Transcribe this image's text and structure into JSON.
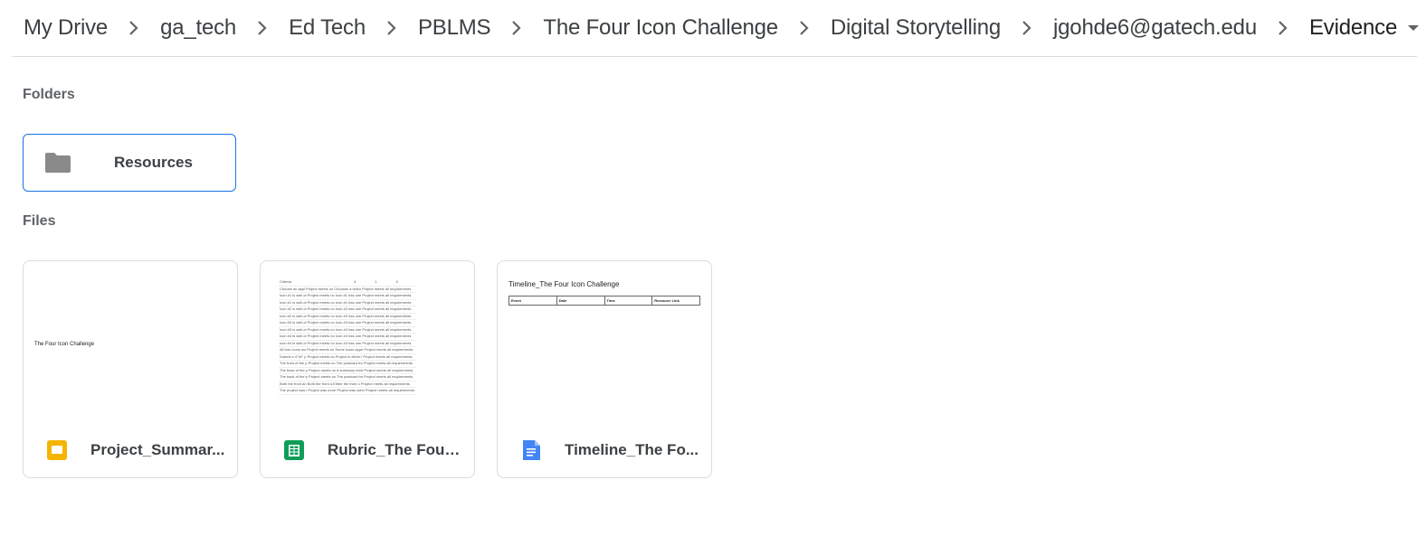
{
  "breadcrumb": {
    "items": [
      "My Drive",
      "ga_tech",
      "Ed Tech",
      "PBLMS",
      "The Four Icon Challenge",
      "Digital Storytelling",
      "jgohde6@gatech.edu"
    ],
    "current": "Evidence"
  },
  "sections": {
    "folders_label": "Folders",
    "files_label": "Files"
  },
  "folders": [
    {
      "name": "Resources",
      "icon": "folder-icon"
    }
  ],
  "files": [
    {
      "name": "Project_Summar...",
      "type": "slides",
      "icon": "google-slides-icon",
      "thumb_title": "The Four Icon Challenge"
    },
    {
      "name": "Rubric_The Four ...",
      "type": "sheets",
      "icon": "google-sheets-icon",
      "thumb_header": [
        "Criteria",
        "3",
        "1",
        "0"
      ],
      "thumb_rows": [
        "Choose an appl Project meets no Chooses a video Project meets all requirements",
        "Icon #1 is well-ct Project meets no Icon #1 has one Project meets all requirements",
        "Icon #1 is well-ct Project meets no Icon #1 has one Project meets all requirements",
        "Icon #2 is well-ct Project meets no Icon #2 has one Project meets all requirements",
        "Icon #2 is well-ct Project meets no Icon #2 has one Project meets all requirements",
        "Icon #3 is well-ct Project meets no Icon #3 has one Project meets all requirements",
        "Icon #3 is well-ct Project meets no Icon #3 has one Project meets all requirements",
        "Icon #4 is well-ct Project meets no Icon #4 has one Project meets all requirements",
        "Icon #4 is well-ct Project meets no Icon #3 has one Project meets all requirements",
        "All four icons wo Project meets no Some icons appe Project meets all requirements",
        "Submit a 4\"x6\" p Project meets no Project is either i Project meets all requirements",
        "The front of the p Project meets no The postcard fro Project meets all requirements",
        "The back of the p Project meets no A summary exist Project meets all requirements",
        "The back of the p Project meets no The postcard fro Project meets all requirements",
        "Both the front an Both the front a Either the front o Project meets all requirements",
        "The project was i Project was more Project was subn Project meets all requirements"
      ]
    },
    {
      "name": "Timeline_The Fo...",
      "type": "docs",
      "icon": "google-docs-icon",
      "thumb_title": "Timeline_The Four Icon Challenge",
      "thumb_columns": [
        "Event",
        "Date",
        "Time",
        "Resource Link"
      ]
    }
  ],
  "colors": {
    "accent": "#1a73e8",
    "slides": "#f4b400",
    "sheets": "#0f9d58",
    "docs": "#4285f4",
    "folder": "#8a8a8a"
  }
}
